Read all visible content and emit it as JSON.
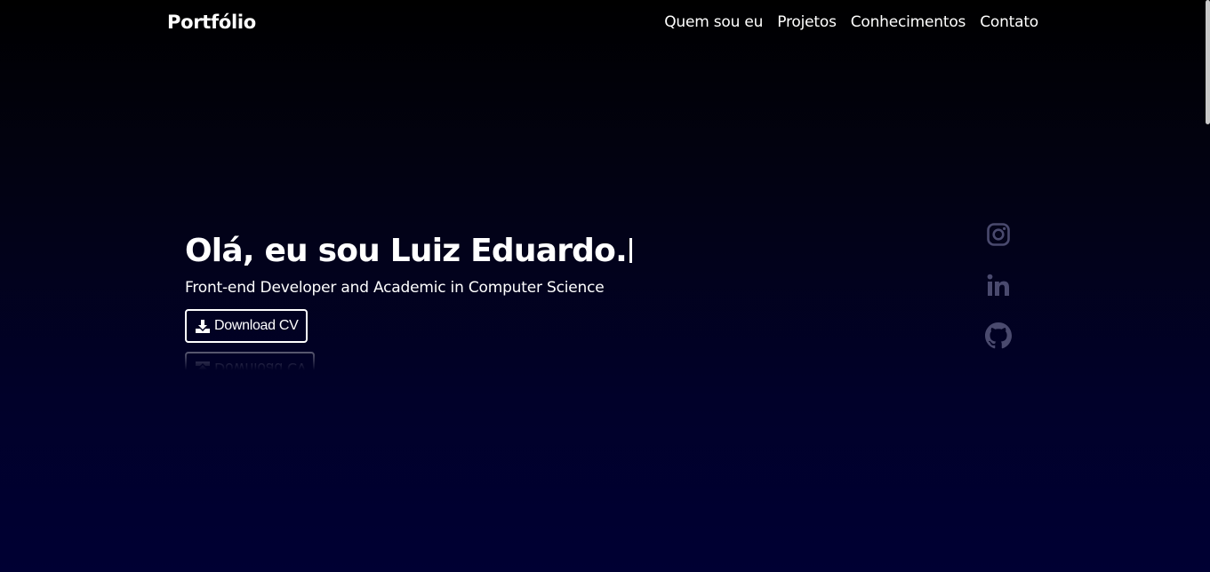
{
  "header": {
    "brand": "Portfólio",
    "nav": [
      {
        "label": "Quem sou eu"
      },
      {
        "label": "Projetos"
      },
      {
        "label": "Conhecimentos"
      },
      {
        "label": "Contato"
      }
    ]
  },
  "hero": {
    "title": "Olá, eu sou Luiz Eduardo.",
    "subtitle": "Front-end Developer and Academic in Computer Science",
    "download_label": "Download CV",
    "download_icon": "download-icon"
  },
  "socials": [
    {
      "icon": "instagram-icon"
    },
    {
      "icon": "linkedin-icon"
    },
    {
      "icon": "github-icon"
    }
  ],
  "colors": {
    "background_top": "#000000",
    "background_bottom": "#000033",
    "text": "#ffffff",
    "social_icon": "#4a4a6e"
  }
}
